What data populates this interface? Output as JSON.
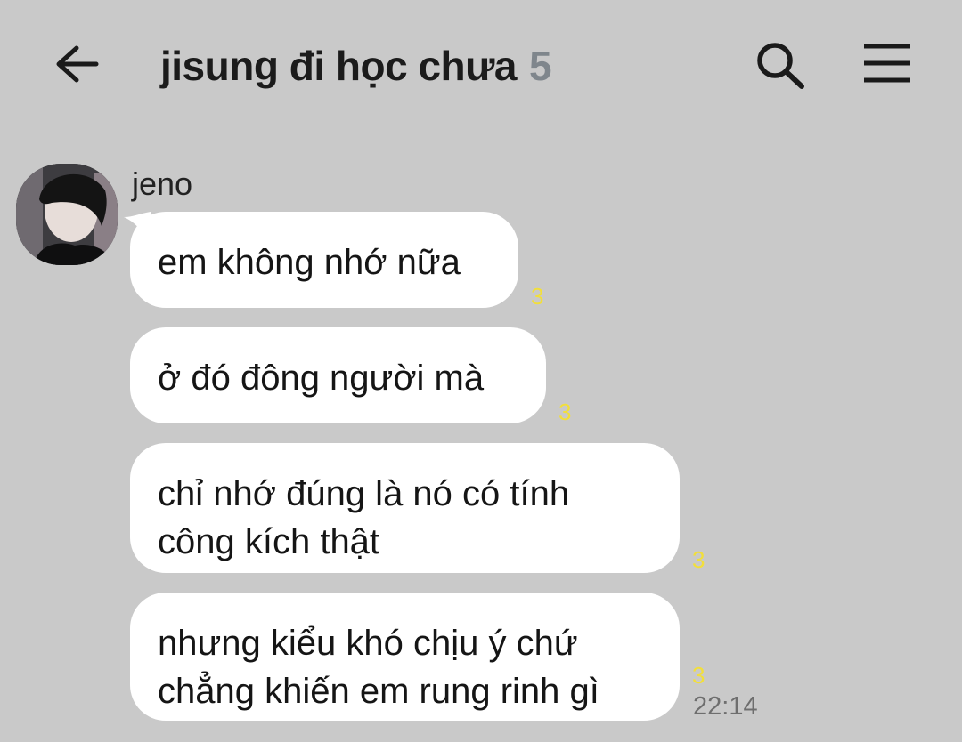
{
  "header": {
    "title": "jisung đi học chưa",
    "member_count": "5",
    "back_icon": "arrow-left-icon",
    "search_icon": "search-icon",
    "menu_icon": "hamburger-menu-icon"
  },
  "chat": {
    "sender": {
      "name": "jeno"
    },
    "messages": [
      {
        "line1": "em không nhớ nữa",
        "line2": "",
        "unread": "3"
      },
      {
        "line1": "ở đó đông người mà",
        "line2": "",
        "unread": "3"
      },
      {
        "line1": "chỉ nhớ đúng là nó có tính",
        "line2": "công kích thật",
        "unread": "3"
      },
      {
        "line1": "nhưng kiểu khó chịu ý chứ",
        "line2": "chẳng khiến em rung rinh gì",
        "unread": "3"
      }
    ],
    "last_timestamp": "22:14"
  },
  "colors": {
    "background": "#c9c9c9",
    "bubble": "#ffffff",
    "unread_count": "#f2df3a",
    "member_count": "#7f868c"
  }
}
